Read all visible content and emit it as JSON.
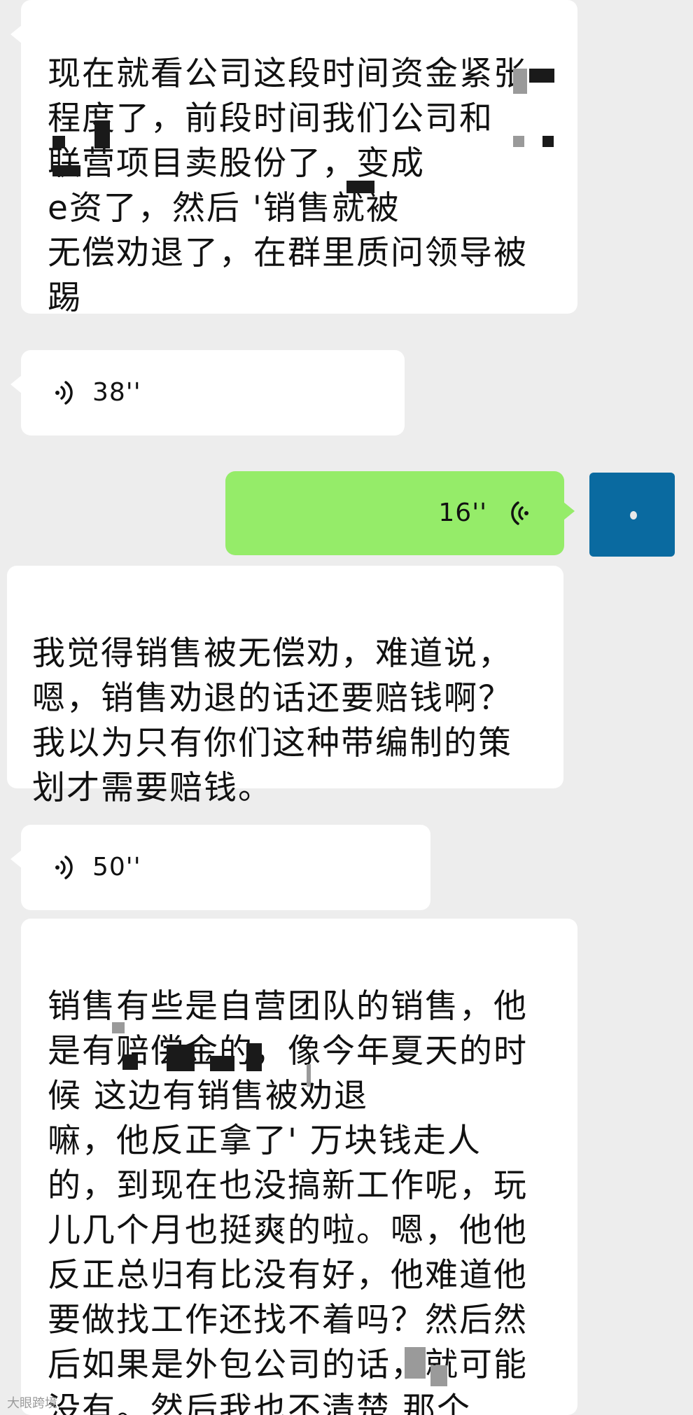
{
  "messages": {
    "m1": "现在就看公司这段时间资金紧张\n程度了，前段时间我们公司和\n      联营项目卖股份了，变成\n   e资了，然后      '销售就被\n无偿劝退了，在群里质问领导被\n踢",
    "v1": "38''",
    "v2": "16''",
    "m2": "我觉得销售被无偿劝，难道说，\n嗯，销售劝退的话还要赔钱啊？\n我以为只有你们这种带编制的策\n划才需要赔钱。",
    "v3": "50''",
    "m3": "销售有些是自营团队的销售，他\n是有赔偿金的，像今年夏天的时\n候              这边有销售被劝退\n嘛，他反正拿了'  万块钱走人\n的，到现在也没搞新工作呢，玩\n儿几个月也挺爽的啦。嗯，他他\n反正总归有比没有好，他难道他\n要做找工作还找不着吗？然后然\n后如果是外包公司的话，就可能\n没有。然后我也不清楚      那个"
  },
  "watermark": "大眼跨境",
  "colors": {
    "background": "#ededed",
    "incoming_bubble": "#ffffff",
    "outgoing_bubble": "#95ec69",
    "avatar": "#0a6aa0"
  },
  "icons": {
    "incoming_voice": "voice-wave-icon",
    "outgoing_voice": "voice-wave-icon"
  }
}
